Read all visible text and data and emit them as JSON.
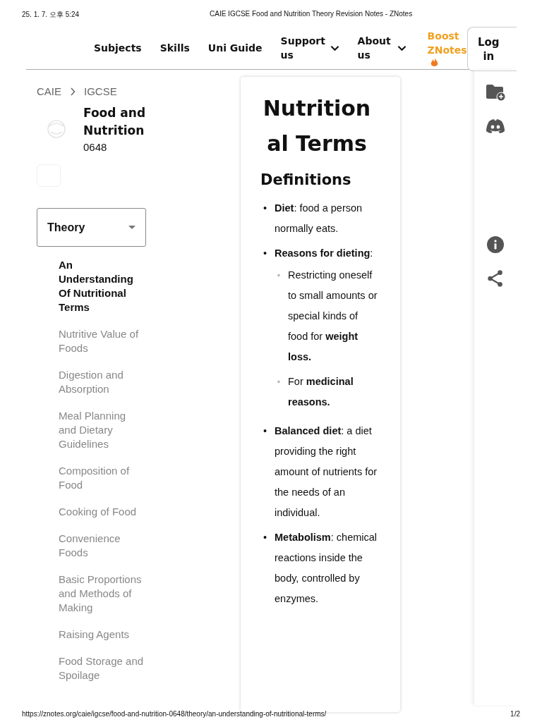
{
  "print_header": {
    "date": "25. 1. 7. 오후 5:24",
    "title": "CAIE IGCSE Food and Nutrition Theory Revision Notes - ZNotes"
  },
  "nav": [
    {
      "label": "Subjects",
      "kind": "link"
    },
    {
      "label": "Skills",
      "kind": "link"
    },
    {
      "label": "Uni Guide",
      "kind": "link"
    },
    {
      "label": "Support us",
      "kind": "dropdown"
    },
    {
      "label": "About us",
      "kind": "dropdown"
    },
    {
      "label": "Boost ZNotes",
      "kind": "boost"
    },
    {
      "label": "Log in",
      "kind": "button"
    }
  ],
  "breadcrumb": [
    "CAIE",
    "IGCSE"
  ],
  "subject": {
    "name": "Food and Nutrition",
    "code": "0648"
  },
  "section_select": {
    "value": "Theory"
  },
  "topics": [
    {
      "label": "An Understanding Of Nutritional Terms",
      "selected": true
    },
    {
      "label": "Nutritive Value of Foods",
      "selected": false
    },
    {
      "label": "Digestion and Absorption",
      "selected": false
    },
    {
      "label": "Meal Planning and Dietary Guidelines",
      "selected": false
    },
    {
      "label": "Composition of Food",
      "selected": false
    },
    {
      "label": "Cooking of Food",
      "selected": false
    },
    {
      "label": "Convenience Foods",
      "selected": false
    },
    {
      "label": "Basic Proportions and Methods of Making",
      "selected": false
    },
    {
      "label": "Raising Agents",
      "selected": false
    },
    {
      "label": "Food Storage and Spoilage",
      "selected": false
    }
  ],
  "article": {
    "title": "Nutritional Terms",
    "heading": "Definitions",
    "items": [
      {
        "marker": "•",
        "text": "**Diet**: food a person normally eats."
      },
      {
        "marker": "•",
        "text": "**Reasons for dieting**:",
        "children": [
          {
            "marker": "◦",
            "text": "Restricting oneself to small amounts or special kinds of food for **weight loss.**"
          },
          {
            "marker": "◦",
            "text": "For **medicinal reasons.**"
          }
        ]
      },
      {
        "marker": "•",
        "text": "**Balanced diet**: a diet providing the right amount of nutrients for the needs of an individual."
      },
      {
        "marker": "•",
        "text": "**Metabolism**: chemical reactions inside the body, controlled by enzymes."
      }
    ]
  },
  "print_footer": {
    "url": "https://znotes.org/caie/igcse/food-and-nutrition-0648/theory/an-understanding-of-nutritional-terms/",
    "page": "1/2"
  }
}
